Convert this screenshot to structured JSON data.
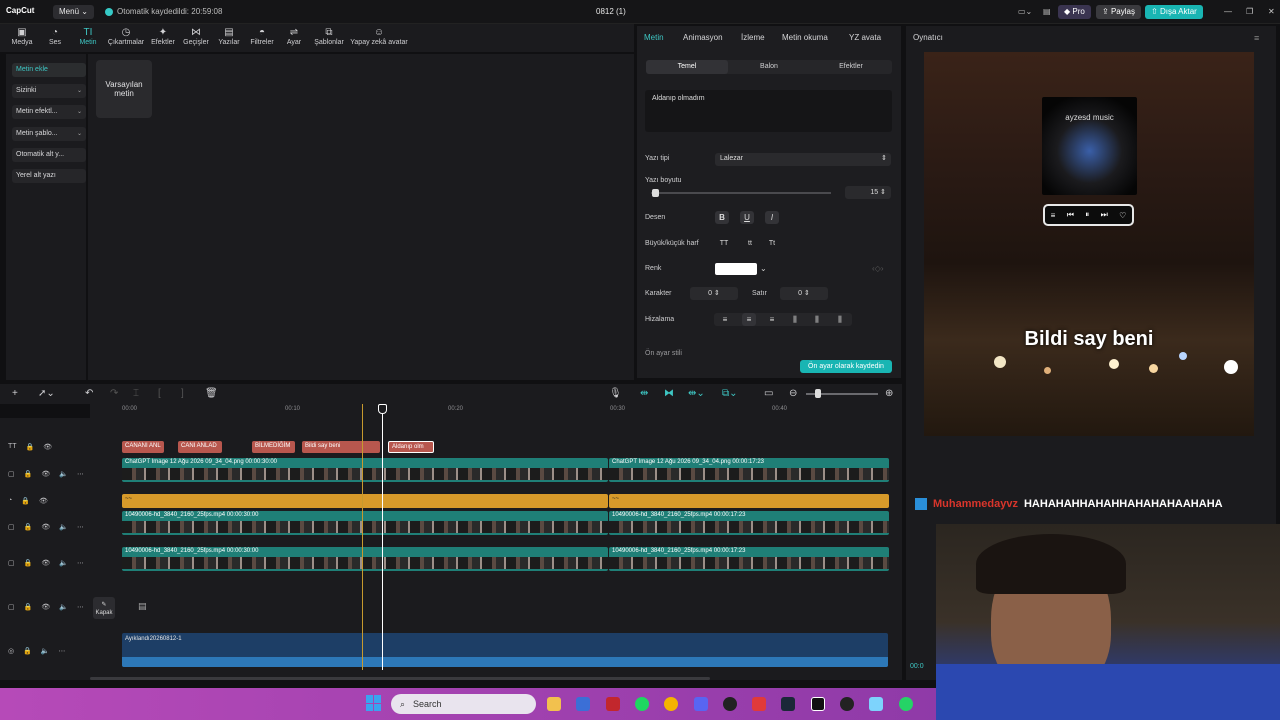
{
  "app": {
    "logo": "CapCut",
    "menu_label": "Menü",
    "autosave": "Otomatik kaydedildi: 20:59:08",
    "project_title": "0812 (1)",
    "pro_label": "Pro",
    "share_label": "Paylaş",
    "export_label": "Dışa Aktar"
  },
  "toolbar": [
    {
      "label": "Medya",
      "icon": "media-icon"
    },
    {
      "label": "Ses",
      "icon": "audio-icon"
    },
    {
      "label": "Metin",
      "icon": "text-icon"
    },
    {
      "label": "Çıkartmalar",
      "icon": "sticker-icon"
    },
    {
      "label": "Efektler",
      "icon": "effects-icon"
    },
    {
      "label": "Geçişler",
      "icon": "transitions-icon"
    },
    {
      "label": "Yazılar",
      "icon": "captions-icon"
    },
    {
      "label": "Filtreler",
      "icon": "filters-icon"
    },
    {
      "label": "Ayar",
      "icon": "adjust-icon"
    },
    {
      "label": "Şablonlar",
      "icon": "templates-icon"
    },
    {
      "label": "Yapay zekâ avatar",
      "icon": "ai-avatar-icon"
    }
  ],
  "sidebar": [
    {
      "label": "Metin ekle"
    },
    {
      "label": "Sizinki"
    },
    {
      "label": "Metin efektl..."
    },
    {
      "label": "Metin şablo..."
    },
    {
      "label": "Otomatik alt y..."
    },
    {
      "label": "Yerel alt yazı"
    }
  ],
  "assets": {
    "default_text": "Varsayılan metin"
  },
  "props": {
    "tabs": [
      "Metin",
      "Animasyon",
      "İzleme",
      "Metin okuma",
      "YZ avata"
    ],
    "subtabs": [
      "Temel",
      "Balon",
      "Efektler"
    ],
    "text_value": "Aldanıp olmadım",
    "font_label": "Yazı tipi",
    "font_value": "Lalezar",
    "size_label": "Yazı boyutu",
    "size_value": "15",
    "size_fraction": 0.02,
    "pattern_label": "Desen",
    "case_label": "Büyük/küçük harf",
    "color_label": "Renk",
    "color_value": "#ffffff",
    "char_label": "Karakter",
    "char_value": "0",
    "line_label": "Satır",
    "line_value": "0",
    "align_label": "Hizalama",
    "preset_style_label": "Ön ayar stili",
    "save_preset": "Ön ayar olarak kaydedin",
    "bold": "B",
    "underline": "U",
    "italic": "I",
    "case_upper": "TT",
    "case_lower": "tt",
    "case_title": "Tt"
  },
  "player": {
    "title": "Oynatıcı",
    "music_title": "ayzesd music",
    "subtitle": "Bildi say beni",
    "chat_name": "Muhammedayvz",
    "chat_message": "HAHAHAHHAHAHHAHAHAHAAHAHA",
    "time": "00:0"
  },
  "timeline": {
    "ticks": [
      "00:00",
      "00:10",
      "00:20",
      "00:30",
      "00:40"
    ],
    "text_clips": [
      "CANANI ANL",
      "CANI ANLAD",
      "BİLMEDİĞİM",
      "Bildi say beni",
      "Aldanıp olm"
    ],
    "video_clips": [
      {
        "label": "ChatGPT Image 12 Ağu 2026 09_34_04.png   00:00:30:00"
      },
      {
        "label": "ChatGPT Image 12 Ağu 2026 09_34_04.png   00:00:17:23"
      }
    ],
    "effect_clips": [
      "~~",
      "~~"
    ],
    "bg_clips": [
      {
        "label": "10490006-hd_3840_2160_25fps.mp4   00:00:30:00"
      },
      {
        "label": "10490006-hd_3840_2160_25fps.mp4   00:00:17:23"
      }
    ],
    "cover_label": "Kapak",
    "audio_label": "Ayıklandı20260812-1"
  },
  "taskbar": {
    "search_placeholder": "Search"
  }
}
